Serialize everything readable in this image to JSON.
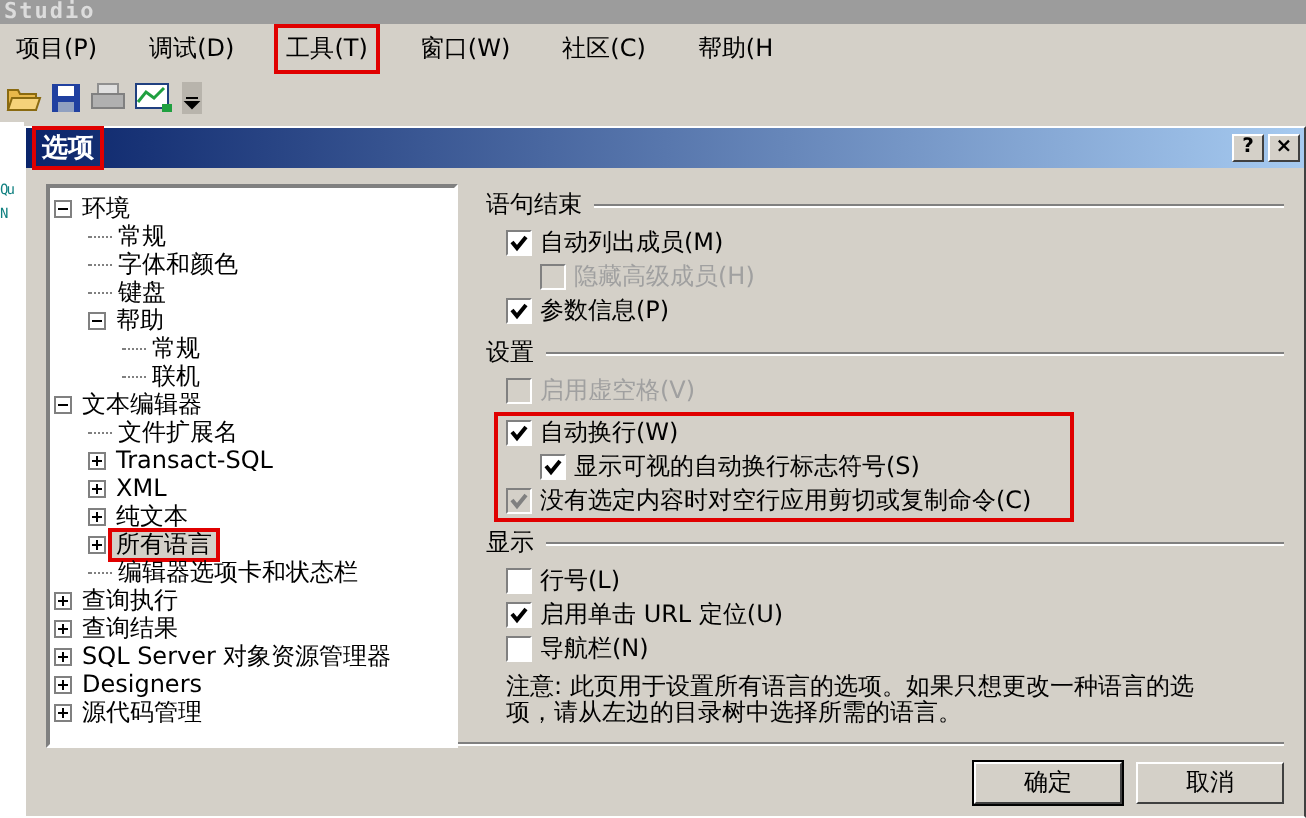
{
  "app_title": "Studio",
  "menu": [
    {
      "label": "项目(P)",
      "highlighted": false
    },
    {
      "label": "调试(D)",
      "highlighted": false
    },
    {
      "label": "工具(T)",
      "highlighted": true
    },
    {
      "label": "窗口(W)",
      "highlighted": false
    },
    {
      "label": "社区(C)",
      "highlighted": false
    },
    {
      "label": "帮助(H",
      "highlighted": false
    }
  ],
  "editor_fragments": [
    "Qu",
    "N"
  ],
  "dialog": {
    "title": "选项",
    "title_highlighted": true,
    "help_button": "?",
    "close_button": "×",
    "tree": [
      {
        "label": "环境",
        "expanded": true,
        "selected": false,
        "children": [
          {
            "label": "常规",
            "selected": false
          },
          {
            "label": "字体和颜色",
            "selected": false
          },
          {
            "label": "键盘",
            "selected": false
          },
          {
            "label": "帮助",
            "expanded": true,
            "selected": false,
            "children": [
              {
                "label": "常规",
                "selected": false
              },
              {
                "label": "联机",
                "selected": false
              }
            ]
          }
        ]
      },
      {
        "label": "文本编辑器",
        "expanded": true,
        "selected": false,
        "children": [
          {
            "label": "文件扩展名",
            "selected": false
          },
          {
            "label": "Transact-SQL",
            "expanded": false,
            "selected": false
          },
          {
            "label": "XML",
            "expanded": false,
            "selected": false
          },
          {
            "label": "纯文本",
            "expanded": false,
            "selected": false
          },
          {
            "label": "所有语言",
            "expanded": false,
            "selected": true
          },
          {
            "label": "编辑器选项卡和状态栏",
            "selected": false
          }
        ]
      },
      {
        "label": "查询执行",
        "expanded": false,
        "selected": false
      },
      {
        "label": "查询结果",
        "expanded": false,
        "selected": false
      },
      {
        "label": "SQL Server 对象资源管理器",
        "expanded": false,
        "selected": false
      },
      {
        "label": "Designers",
        "expanded": false,
        "selected": false
      },
      {
        "label": "源代码管理",
        "expanded": false,
        "selected": false
      }
    ],
    "sections": [
      {
        "title": "语句结束",
        "options": [
          {
            "label": "自动列出成员(M)",
            "checked": true,
            "disabled": false,
            "highlighted": false,
            "children": [
              {
                "label": "隐藏高级成员(H)",
                "checked": false,
                "disabled": true
              }
            ]
          },
          {
            "label": "参数信息(P)",
            "checked": true,
            "disabled": false,
            "highlighted": false
          }
        ]
      },
      {
        "title": "设置",
        "options": [
          {
            "label": "启用虚空格(V)",
            "checked": false,
            "disabled": true,
            "highlighted": false
          },
          {
            "label": "自动换行(W)",
            "checked": true,
            "disabled": false,
            "highlighted": true,
            "children": [
              {
                "label": "显示可视的自动换行标志符号(S)",
                "checked": true,
                "disabled": false
              }
            ]
          },
          {
            "label": "没有选定内容时对空行应用剪切或复制命令(C)",
            "checked": true,
            "grayed": true,
            "disabled": false,
            "highlighted": true
          }
        ]
      },
      {
        "title": "显示",
        "options": [
          {
            "label": "行号(L)",
            "checked": false,
            "disabled": false,
            "highlighted": false
          },
          {
            "label": "启用单击 URL 定位(U)",
            "checked": true,
            "disabled": false,
            "highlighted": false
          },
          {
            "label": "导航栏(N)",
            "checked": false,
            "disabled": false,
            "highlighted": false
          }
        ]
      }
    ],
    "note": "注意: 此页用于设置所有语言的选项。如果只想更改一种语言的选项，请从左边的目录树中选择所需的语言。",
    "buttons": [
      {
        "label": "确定",
        "default": true
      },
      {
        "label": "取消",
        "default": false
      }
    ]
  }
}
